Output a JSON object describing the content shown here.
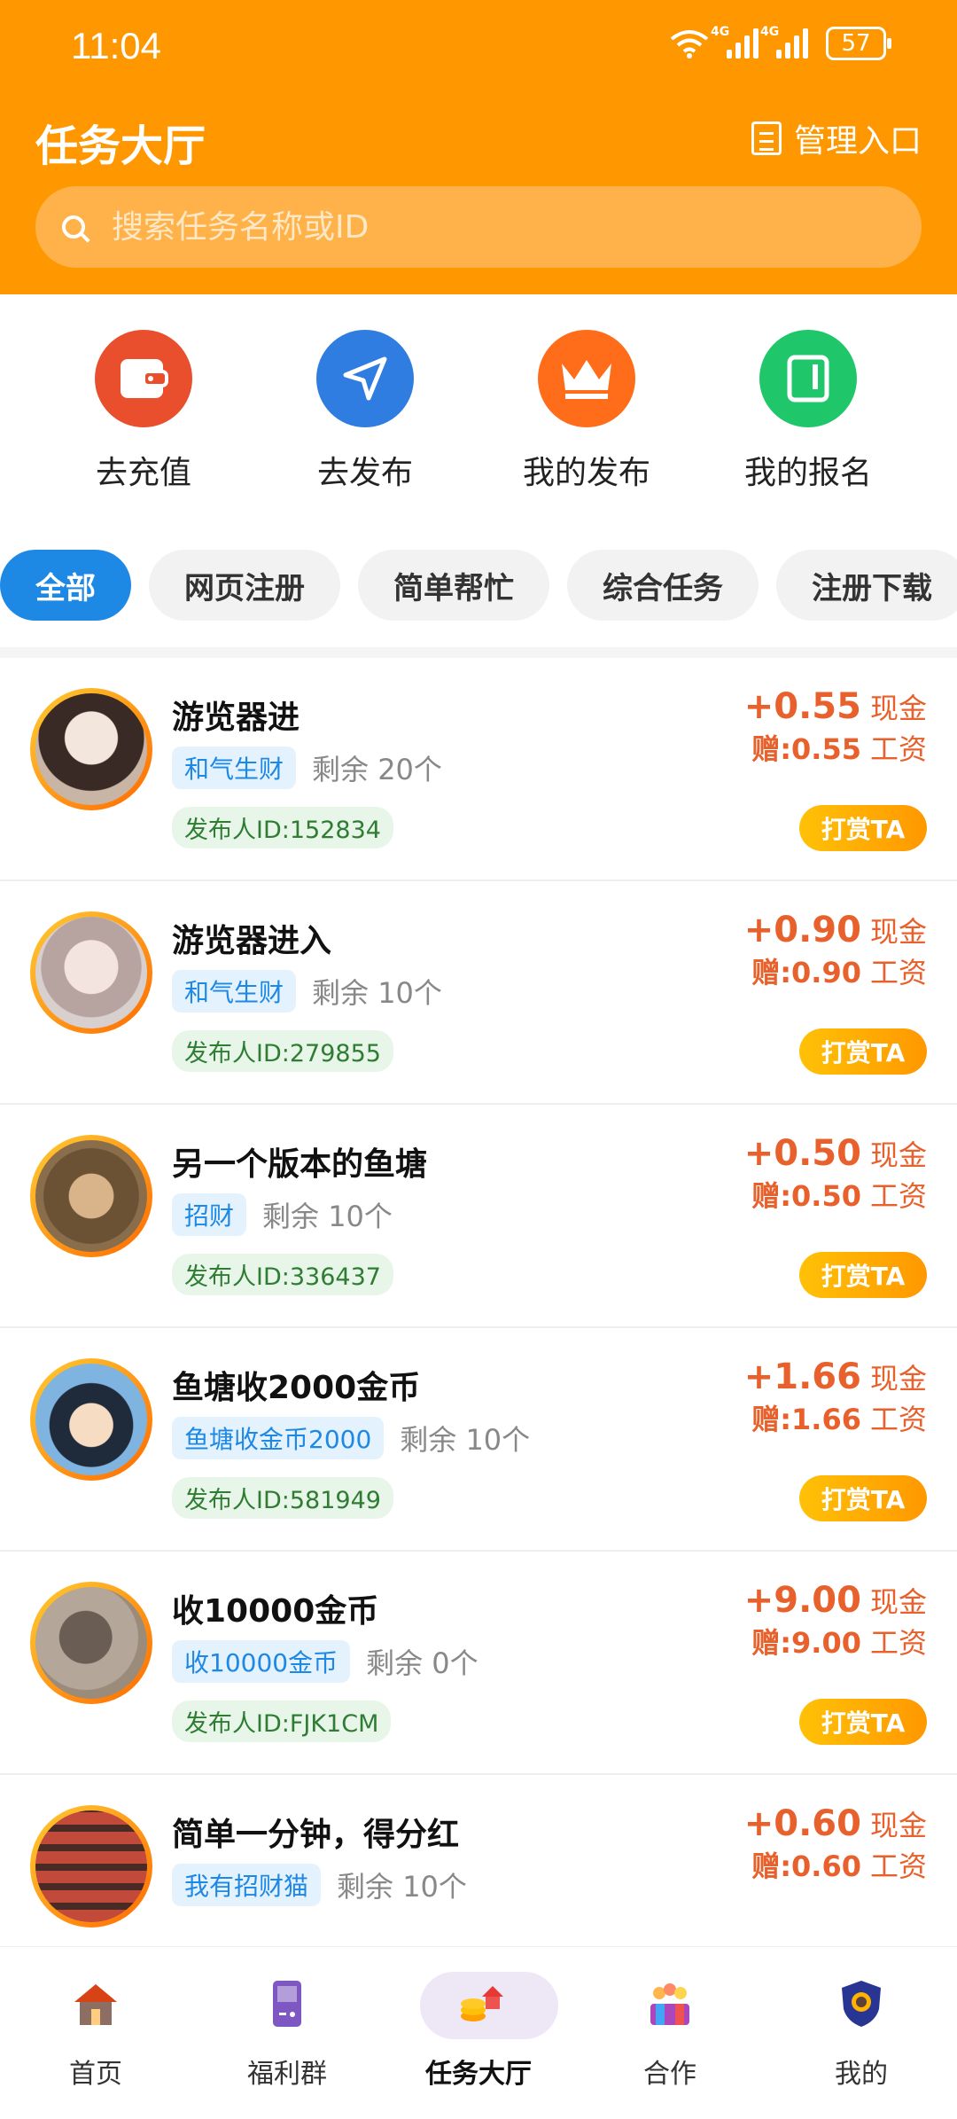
{
  "status_bar": {
    "time": "11:04",
    "net1": "4G",
    "net2": "4G",
    "battery": "57"
  },
  "header": {
    "title": "任务大厅",
    "manage_label": "管理入口",
    "search_placeholder": "搜索任务名称或ID"
  },
  "quick_actions": [
    {
      "label": "去充值",
      "icon": "wallet-icon",
      "color": "#e94f2c"
    },
    {
      "label": "去发布",
      "icon": "send-icon",
      "color": "#2f7de1"
    },
    {
      "label": "我的发布",
      "icon": "crown-icon",
      "color": "#ff6d1a"
    },
    {
      "label": "我的报名",
      "icon": "notebook-icon",
      "color": "#1fc76a"
    }
  ],
  "tabs": [
    "全部",
    "网页注册",
    "简单帮忙",
    "综合任务",
    "注册下载"
  ],
  "tasks": [
    {
      "title": "游览器进",
      "tag": "和气生财",
      "remain": "剩余 20个",
      "publisher": "发布人ID:152834",
      "price": "+0.55",
      "unit": "现金",
      "gift": "赠:0.55",
      "gift_unit": "工资",
      "button": "打赏TA",
      "avatar_color": "#c9b5a5"
    },
    {
      "title": "游览器进入",
      "tag": "和气生财",
      "remain": "剩余 10个",
      "publisher": "发布人ID:279855",
      "price": "+0.90",
      "unit": "现金",
      "gift": "赠:0.90",
      "gift_unit": "工资",
      "button": "打赏TA",
      "avatar_color": "#d8cfcf"
    },
    {
      "title": "另一个版本的鱼塘",
      "tag": "招财",
      "remain": "剩余 10个",
      "publisher": "发布人ID:336437",
      "price": "+0.50",
      "unit": "现金",
      "gift": "赠:0.50",
      "gift_unit": "工资",
      "button": "打赏TA",
      "avatar_color": "#8a6e4b"
    },
    {
      "title": "鱼塘收2000金币",
      "tag": "鱼塘收金币2000",
      "remain": "剩余 10个",
      "publisher": "发布人ID:581949",
      "price": "+1.66",
      "unit": "现金",
      "gift": "赠:1.66",
      "gift_unit": "工资",
      "button": "打赏TA",
      "avatar_color": "#7fb4e0"
    },
    {
      "title": "收10000金币",
      "tag": "收10000金币",
      "remain": "剩余 0个",
      "publisher": "发布人ID:FJK1CM",
      "price": "+9.00",
      "unit": "现金",
      "gift": "赠:9.00",
      "gift_unit": "工资",
      "button": "打赏TA",
      "avatar_color": "#9a8b7a"
    },
    {
      "title": "简单一分钟，得分红",
      "tag": "我有招财猫",
      "remain": "剩余 10个",
      "publisher": "",
      "price": "+0.60",
      "unit": "现金",
      "gift": "赠:0.60",
      "gift_unit": "工资",
      "button": "",
      "avatar_color": "#c24a3a"
    }
  ],
  "bottom_nav": [
    {
      "label": "首页",
      "icon": "house-icon"
    },
    {
      "label": "福利群",
      "icon": "gameboy-icon"
    },
    {
      "label": "任务大厅",
      "icon": "task-hall-icon"
    },
    {
      "label": "合作",
      "icon": "cooperation-icon"
    },
    {
      "label": "我的",
      "icon": "shield-avatar-icon"
    }
  ]
}
